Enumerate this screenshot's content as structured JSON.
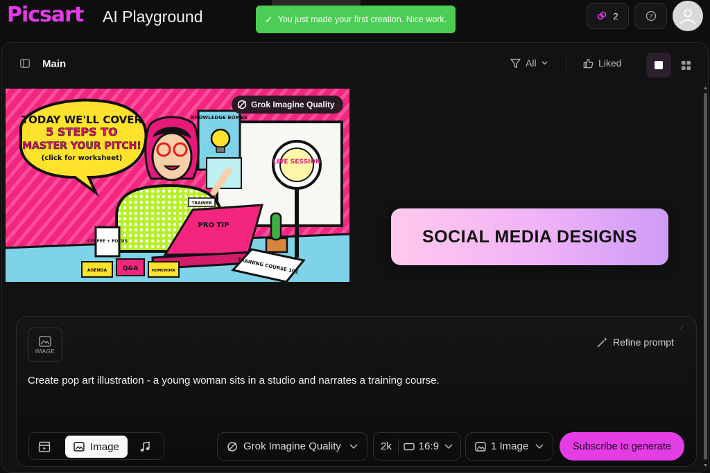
{
  "brand": {
    "logo": "Picsart",
    "app_title": "AI Playground",
    "accent": "#e43bea"
  },
  "toast": {
    "message": "You just made your first creation. Nice work.",
    "color": "#4ccd55"
  },
  "header": {
    "credits_count": "2"
  },
  "panel": {
    "title": "Main",
    "filter_label": "All",
    "liked_label": "Liked"
  },
  "gallery": {
    "image_badge": "Grok Imagine Quality",
    "banner_text": "SOCIAL MEDIA DESIGNS",
    "artwork_text": {
      "speech_line1": "TODAY WE'LL COVER",
      "speech_line2": "5 STEPS TO",
      "speech_line3": "MASTER YOUR PITCH!",
      "speech_line4": "(click for worksheet)",
      "board_note": "KNOWLEDGE BOMBS",
      "ring_light": "LIVE SESSION",
      "laptop_sticker": "PRO TIP",
      "cup_label": "COFFEE + FOCUS",
      "name_tag": "TRAINER",
      "sticky1": "AGENDA",
      "sticky2": "Q&A",
      "sticky3": "HOMEWORK",
      "notebook": "TRAINING COURSE 101"
    }
  },
  "prompt": {
    "upload_label": "IMAGE",
    "refine_label": "Refine prompt",
    "text": "Create pop art illustration - a young woman sits in a studio and narrates a training course."
  },
  "controls": {
    "mode_image_label": "Image",
    "model_label": "Grok Imagine Quality",
    "resolution": "2k",
    "aspect_ratio": "16:9",
    "count_label": "1 Image",
    "subscribe_label": "Subscribe to generate"
  }
}
